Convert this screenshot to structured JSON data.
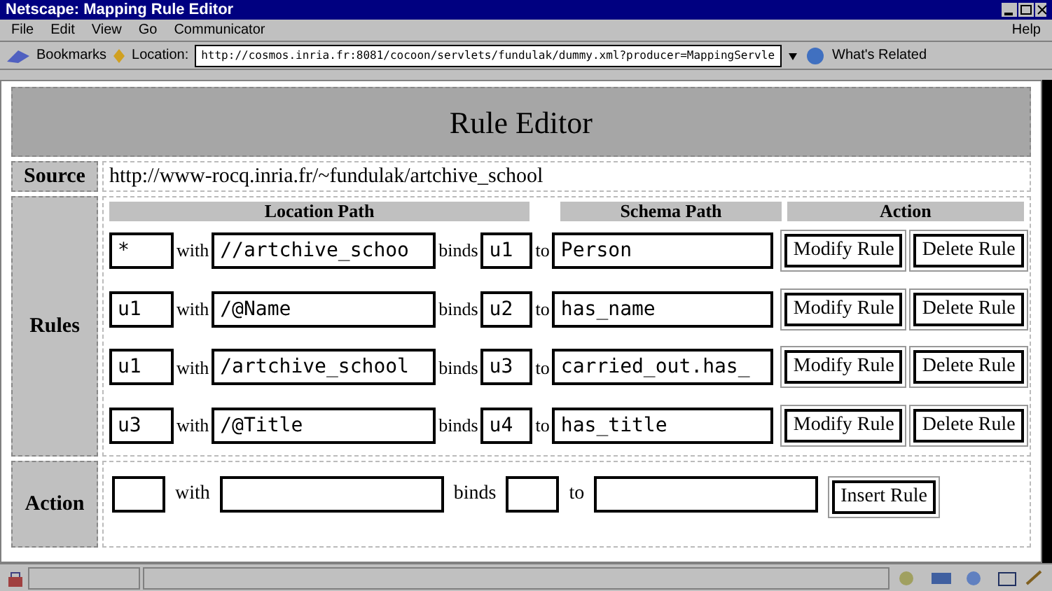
{
  "window": {
    "title": "Netscape: Mapping Rule Editor"
  },
  "menu": {
    "items": [
      "File",
      "Edit",
      "View",
      "Go",
      "Communicator"
    ],
    "help": "Help"
  },
  "toolbar": {
    "bookmarks": "Bookmarks",
    "location_label": "Location:",
    "url": "http://cosmos.inria.fr:8081/cocoon/servlets/fundulak/dummy.xml?producer=MappingServle",
    "whats_related": "What's Related"
  },
  "page": {
    "title": "Rule Editor",
    "source": {
      "label": "Source",
      "value": "http://www-rocq.inria.fr/~fundulak/artchive_school"
    },
    "rules": {
      "label": "Rules",
      "columns": [
        "Location Path",
        "Schema Path",
        "Action"
      ],
      "rows": [
        {
          "variable": "*",
          "with": "with",
          "path": "//artchive_schoo",
          "binds": "binds",
          "binding": "u1",
          "to": "to",
          "schema": "Person",
          "buttons": [
            "Modify Rule",
            "Delete Rule"
          ]
        },
        {
          "variable": "u1",
          "with": "with",
          "path": "/@Name",
          "binds": "binds",
          "binding": "u2",
          "to": "to",
          "schema": "has_name",
          "buttons": [
            "Modify Rule",
            "Delete Rule"
          ]
        },
        {
          "variable": "u1",
          "with": "with",
          "path": "/artchive_school",
          "binds": "binds",
          "binding": "u3",
          "to": "to",
          "schema": "carried_out.has_",
          "buttons": [
            "Modify Rule",
            "Delete Rule"
          ]
        },
        {
          "variable": "u3",
          "with": "with",
          "path": "/@Title",
          "binds": "binds",
          "binding": "u4",
          "to": "to",
          "schema": "has_title",
          "buttons": [
            "Modify Rule",
            "Delete Rule"
          ]
        }
      ]
    },
    "action": {
      "label": "Action",
      "with": "with",
      "binds": "binds",
      "to": "to",
      "button": "Insert Rule"
    }
  }
}
